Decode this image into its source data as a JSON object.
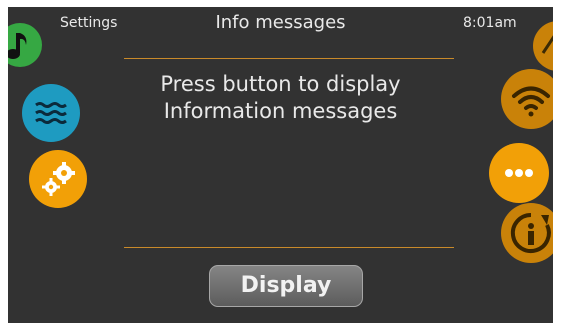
{
  "header": {
    "settings_label": "Settings",
    "title": "Info messages",
    "time": "8:01am"
  },
  "message": {
    "line1": "Press button to display",
    "line2": "Information messages"
  },
  "display_button": {
    "label": "Display"
  },
  "left_icons": [
    "music-icon",
    "water-icon",
    "gears-icon"
  ],
  "right_icons": [
    "partial-icon",
    "wifi-icon",
    "more-icon",
    "info-icon"
  ],
  "colors": {
    "background": "#323232",
    "text": "#e9e9e9",
    "divider": "#c98a2a",
    "orange": "#f2a007",
    "dark_orange": "#c98209",
    "green": "#36a843",
    "teal": "#1e9bc1"
  }
}
